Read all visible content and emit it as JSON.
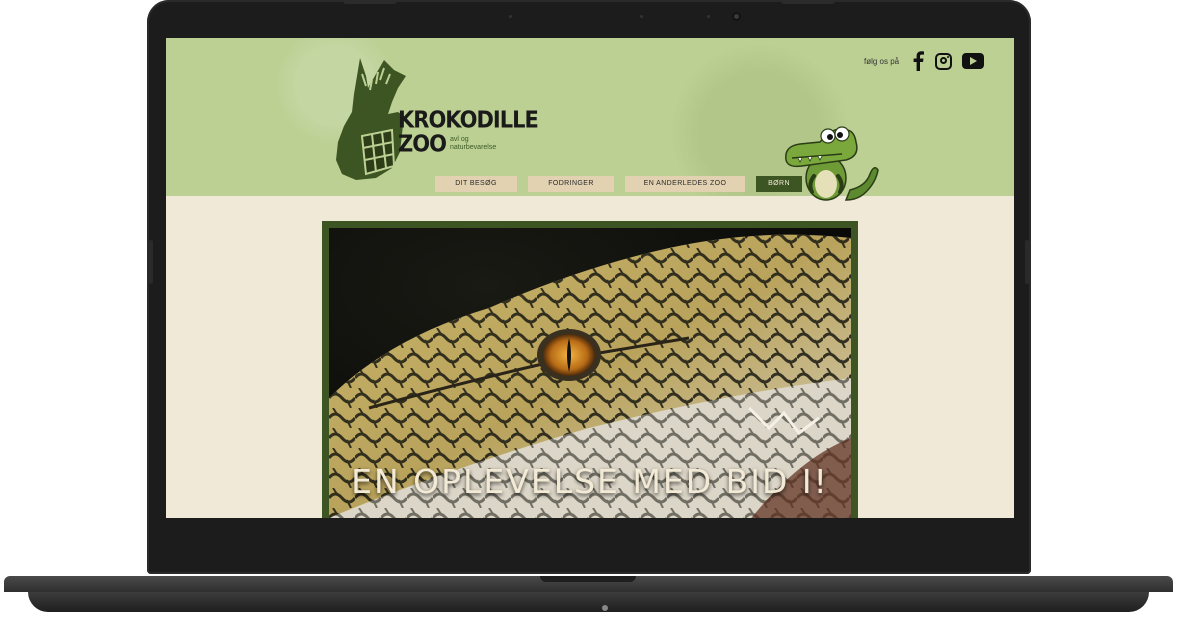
{
  "site": {
    "logo": {
      "line1": "KROKODILLE",
      "line2": "ZOO",
      "subtitle_line1": "avl og",
      "subtitle_line2": "naturbevarelse"
    },
    "social": {
      "label": "følg os på",
      "icons": [
        "facebook-icon",
        "instagram-icon",
        "youtube-icon"
      ]
    },
    "nav": [
      {
        "label": "DIT BESØG",
        "active": false
      },
      {
        "label": "FODRINGER",
        "active": false
      },
      {
        "label": "EN ANDERLEDES ZOO",
        "active": false
      },
      {
        "label": "BØRN",
        "active": true
      }
    ],
    "hero": {
      "title": "EN OPLEVELSE MED BID I!"
    },
    "colors": {
      "header_bg": "#bcd094",
      "page_bg": "#f0e9d8",
      "accent_dark_green": "#3d5423",
      "nav_bg": "#e2d2b2"
    }
  }
}
